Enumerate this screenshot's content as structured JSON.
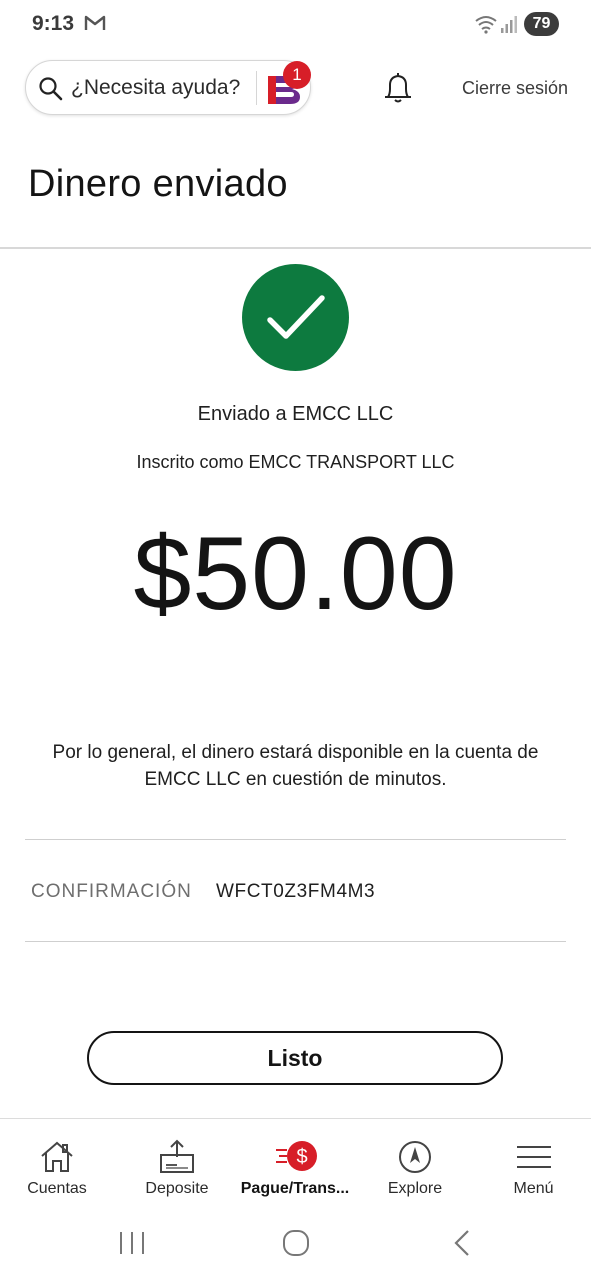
{
  "status_bar": {
    "time": "9:13",
    "battery": "79"
  },
  "header": {
    "search_label": "¿Necesita ayuda?",
    "fargo_badge": "1",
    "logout_label": "Cierre sesión"
  },
  "page": {
    "title": "Dinero enviado"
  },
  "result": {
    "sent_to": "Enviado a EMCC LLC",
    "enrolled_as": "Inscrito como EMCC TRANSPORT LLC",
    "amount": "$50.00",
    "availability": "Por lo general, el dinero estará disponible en la cuenta de EMCC LLC en cuestión de minutos.",
    "confirmation_label": "CONFIRMACIÓN",
    "confirmation_value": "WFCT0Z3FM4M3",
    "done_label": "Listo"
  },
  "bottom_nav": {
    "items": [
      {
        "label": "Cuentas",
        "icon": "home-icon"
      },
      {
        "label": "Deposite",
        "icon": "deposit-icon"
      },
      {
        "label": "Pague/Trans...",
        "icon": "pay-transfer-icon",
        "active": true
      },
      {
        "label": "Explore",
        "icon": "compass-icon"
      },
      {
        "label": "Menú",
        "icon": "hamburger-menu-icon"
      }
    ]
  },
  "colors": {
    "success_green": "#0d7a3f",
    "brand_red": "#d71e28",
    "fargo_purple": "#6b2a8c"
  }
}
